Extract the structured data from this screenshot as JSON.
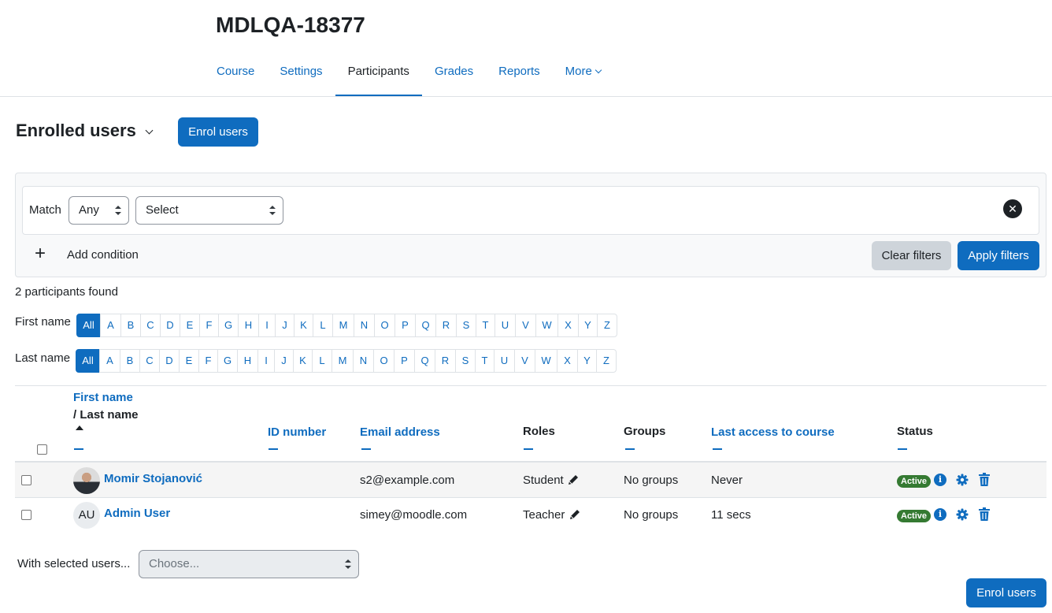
{
  "page": {
    "title": "MDLQA-18377"
  },
  "nav": {
    "tabs": [
      {
        "label": "Course"
      },
      {
        "label": "Settings"
      },
      {
        "label": "Participants"
      },
      {
        "label": "Grades"
      },
      {
        "label": "Reports"
      },
      {
        "label": "More"
      }
    ],
    "active": "Participants"
  },
  "heading": {
    "title": "Enrolled users",
    "enrol_button": "Enrol users"
  },
  "filter": {
    "match_label": "Match",
    "match_value": "Any",
    "type_value": "Select",
    "add_condition": "Add condition",
    "clear_filters": "Clear filters",
    "apply_filters": "Apply filters"
  },
  "summary": {
    "found": "2 participants found"
  },
  "initials": {
    "firstname_label": "First name",
    "lastname_label": "Last name",
    "letters": [
      "All",
      "A",
      "B",
      "C",
      "D",
      "E",
      "F",
      "G",
      "H",
      "I",
      "J",
      "K",
      "L",
      "M",
      "N",
      "O",
      "P",
      "Q",
      "R",
      "S",
      "T",
      "U",
      "V",
      "W",
      "X",
      "Y",
      "Z"
    ]
  },
  "table": {
    "headers": {
      "first_name": "First name",
      "last_name": "/ Last name",
      "id_number": "ID number",
      "email": "Email address",
      "roles": "Roles",
      "groups": "Groups",
      "last_access": "Last access to course",
      "status": "Status"
    },
    "rows": [
      {
        "name": "Momir Stojanović",
        "avatar": "photo",
        "email": "s2@example.com",
        "role": "Student",
        "groups": "No groups",
        "last_access": "Never",
        "status": "Active"
      },
      {
        "name": "Admin User",
        "avatar": "AU",
        "email": "simey@moodle.com",
        "role": "Teacher",
        "groups": "No groups",
        "last_access": "11 secs",
        "status": "Active"
      }
    ]
  },
  "bulk": {
    "label": "With selected users...",
    "placeholder": "Choose..."
  },
  "footer": {
    "enrol_button": "Enrol users"
  },
  "colors": {
    "primary": "#0f6cbf",
    "success": "#357a32",
    "text": "#1d2125"
  },
  "icons": [
    "chevron-down-icon",
    "plus-icon",
    "close-icon",
    "sort-asc-icon",
    "pencil-icon",
    "info-icon",
    "gear-icon",
    "trash-icon"
  ]
}
